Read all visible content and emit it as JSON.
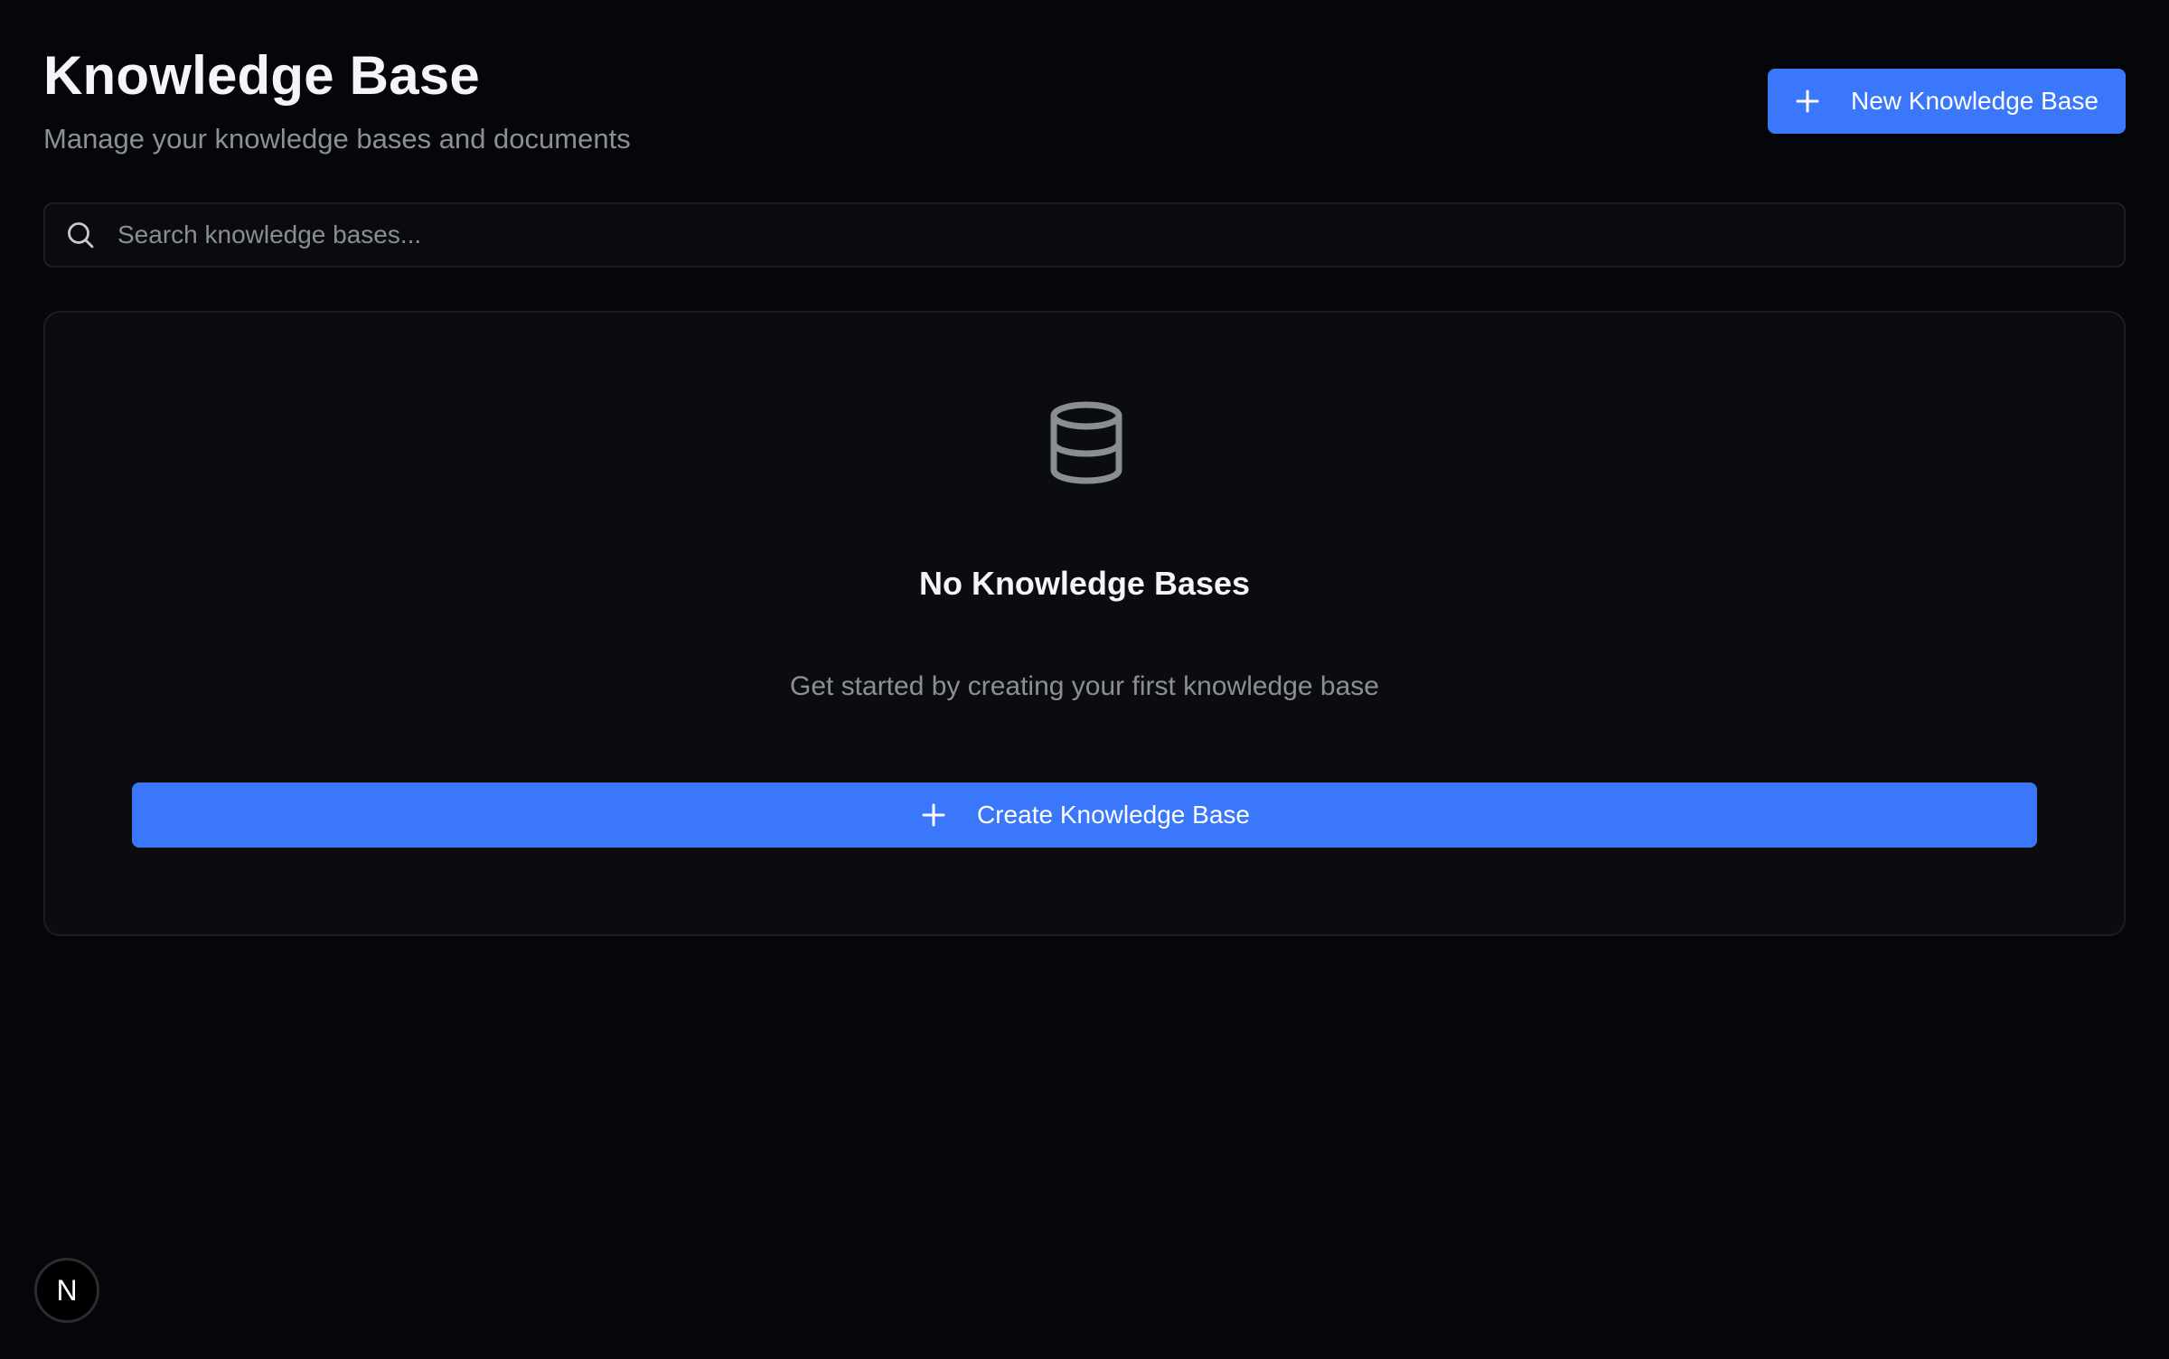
{
  "header": {
    "title": "Knowledge Base",
    "subtitle": "Manage your knowledge bases and documents"
  },
  "toolbar": {
    "new_button_label": "New Knowledge Base",
    "new_button_icon": "plus-icon"
  },
  "search": {
    "placeholder": "Search knowledge bases...",
    "value": "",
    "icon": "search-icon"
  },
  "empty_state": {
    "icon": "database-icon",
    "title": "No Knowledge Bases",
    "description": "Get started by creating your first knowledge base",
    "button_label": "Create Knowledge Base",
    "button_icon": "plus-icon"
  },
  "badge": {
    "letter": "N"
  },
  "colors": {
    "background": "#05060a",
    "card": "#0b0c10",
    "accent": "#3b77fb",
    "muted_text": "#8c8f96"
  }
}
